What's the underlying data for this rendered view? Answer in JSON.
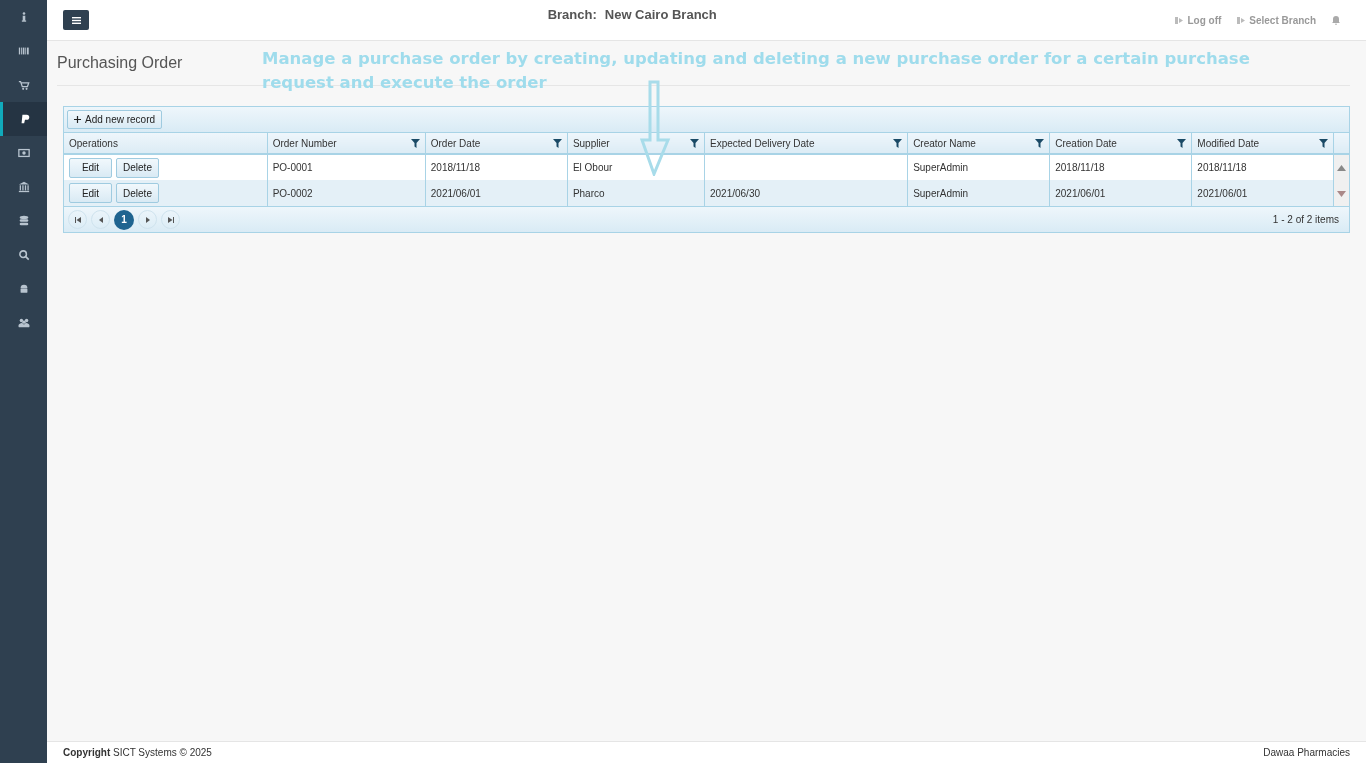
{
  "sidebar": {
    "items": [
      {
        "selected": false
      },
      {
        "selected": false
      },
      {
        "selected": false
      },
      {
        "selected": true
      },
      {
        "selected": false
      },
      {
        "selected": false
      },
      {
        "selected": false
      },
      {
        "selected": false
      },
      {
        "selected": false
      },
      {
        "selected": false
      }
    ]
  },
  "topbar": {
    "branch_label": "Branch:",
    "branch_name": "New Cairo Branch",
    "links": [
      "Log off",
      "Select Branch"
    ]
  },
  "page_title": "Purchasing Order",
  "annotation": "Manage a purchase order by creating, updating and deleting a new purchase order for a certain purchase request and execute the order",
  "grid": {
    "toolbar_button": "Add new record",
    "columns": [
      {
        "title": "Operations",
        "filterable": false
      },
      {
        "title": "Order Number",
        "filterable": true
      },
      {
        "title": "Order Date",
        "filterable": true
      },
      {
        "title": "Supplier",
        "filterable": true
      },
      {
        "title": "Expected Delivery Date",
        "filterable": true
      },
      {
        "title": "Creator Name",
        "filterable": true
      },
      {
        "title": "Creation Date",
        "filterable": true
      },
      {
        "title": "Modified Date",
        "filterable": true
      }
    ],
    "rows": [
      [
        [
          "Edit",
          "Delete"
        ],
        "PO-0001",
        "2018/11/18",
        "El Obour",
        "",
        "SuperAdmin",
        "2018/11/18",
        "2018/11/18"
      ],
      [
        [
          "Edit",
          "Delete"
        ],
        "PO-0002",
        "2021/06/01",
        "Pharco",
        "2021/06/30",
        "SuperAdmin",
        "2021/06/01",
        "2021/06/01"
      ]
    ],
    "pager": {
      "pages": [
        {
          "label": "1",
          "selected": true
        }
      ],
      "info": "1 - 2 of 2 items"
    }
  },
  "footer": {
    "copyright": "**Copyright** SICT Systems © 2025",
    "company": "Dawaa Pharmacies"
  }
}
